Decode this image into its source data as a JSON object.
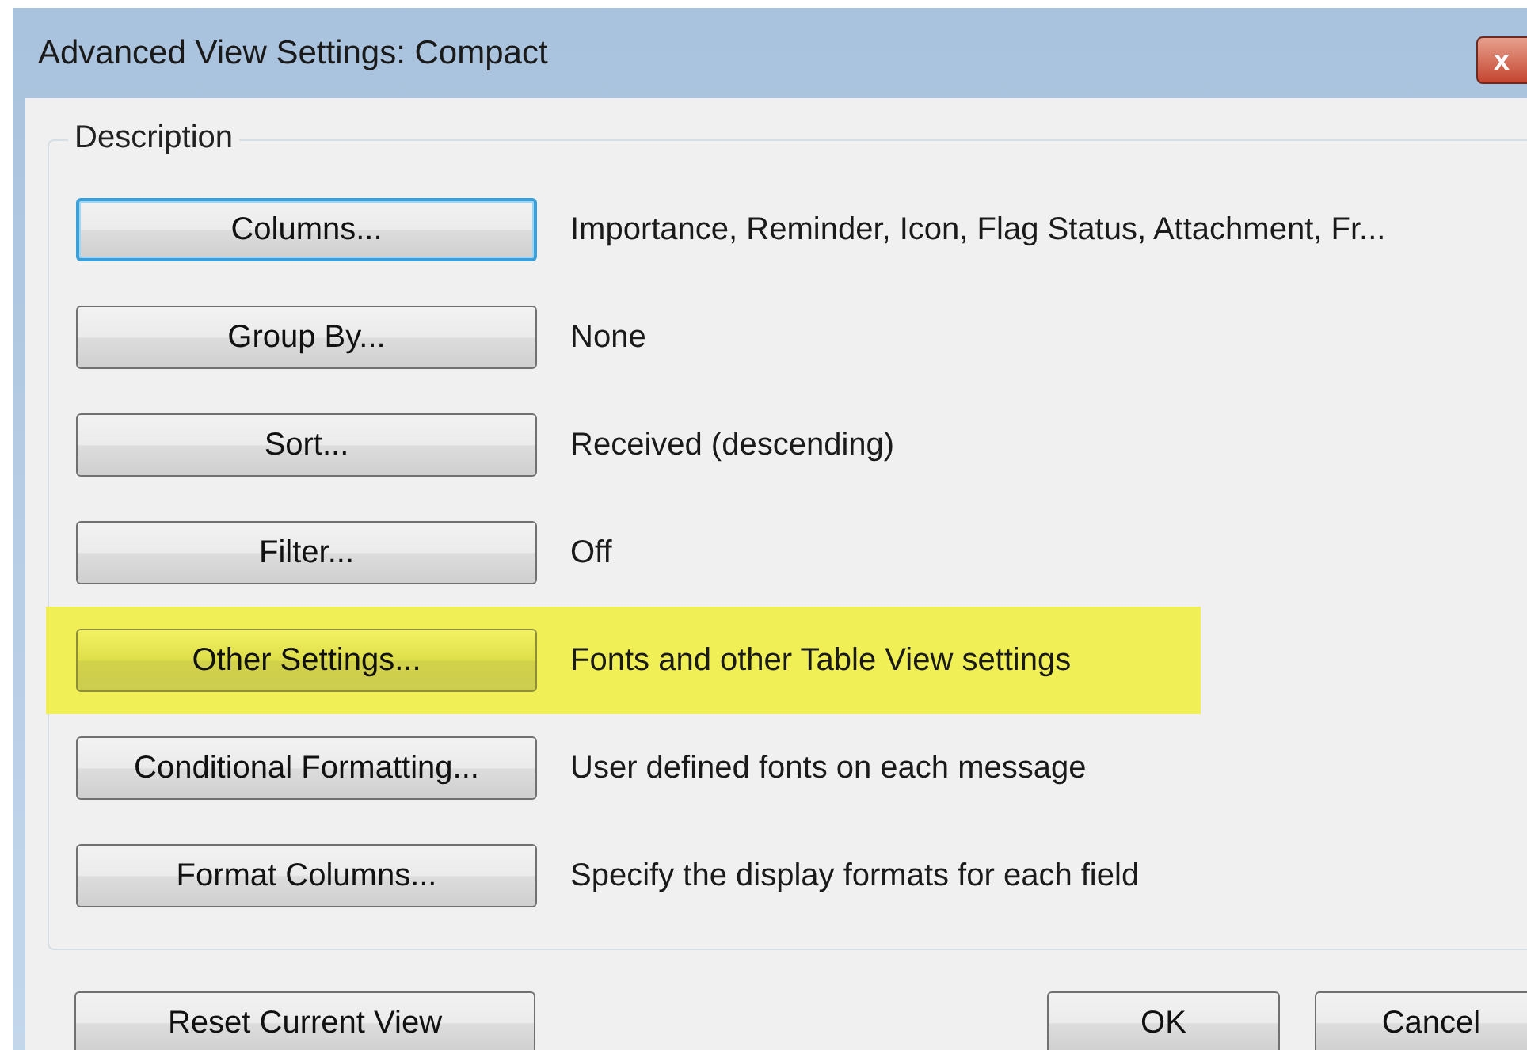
{
  "window": {
    "title": "Advanced View Settings: Compact",
    "close": "x"
  },
  "group": {
    "label": "Description"
  },
  "rows": [
    {
      "button": "Columns...",
      "description": "Importance, Reminder, Icon, Flag Status, Attachment, Fr...",
      "focused": true,
      "highlighted": false
    },
    {
      "button": "Group By...",
      "description": "None",
      "focused": false,
      "highlighted": false
    },
    {
      "button": "Sort...",
      "description": "Received (descending)",
      "focused": false,
      "highlighted": false
    },
    {
      "button": "Filter...",
      "description": "Off",
      "focused": false,
      "highlighted": false
    },
    {
      "button": "Other Settings...",
      "description": "Fonts and other Table View settings",
      "focused": false,
      "highlighted": true
    },
    {
      "button": "Conditional Formatting...",
      "description": "User defined fonts on each message",
      "focused": false,
      "highlighted": false
    },
    {
      "button": "Format Columns...",
      "description": "Specify the display formats for each field",
      "focused": false,
      "highlighted": false
    }
  ],
  "footer": {
    "reset": "Reset Current View",
    "ok": "OK",
    "cancel": "Cancel"
  }
}
